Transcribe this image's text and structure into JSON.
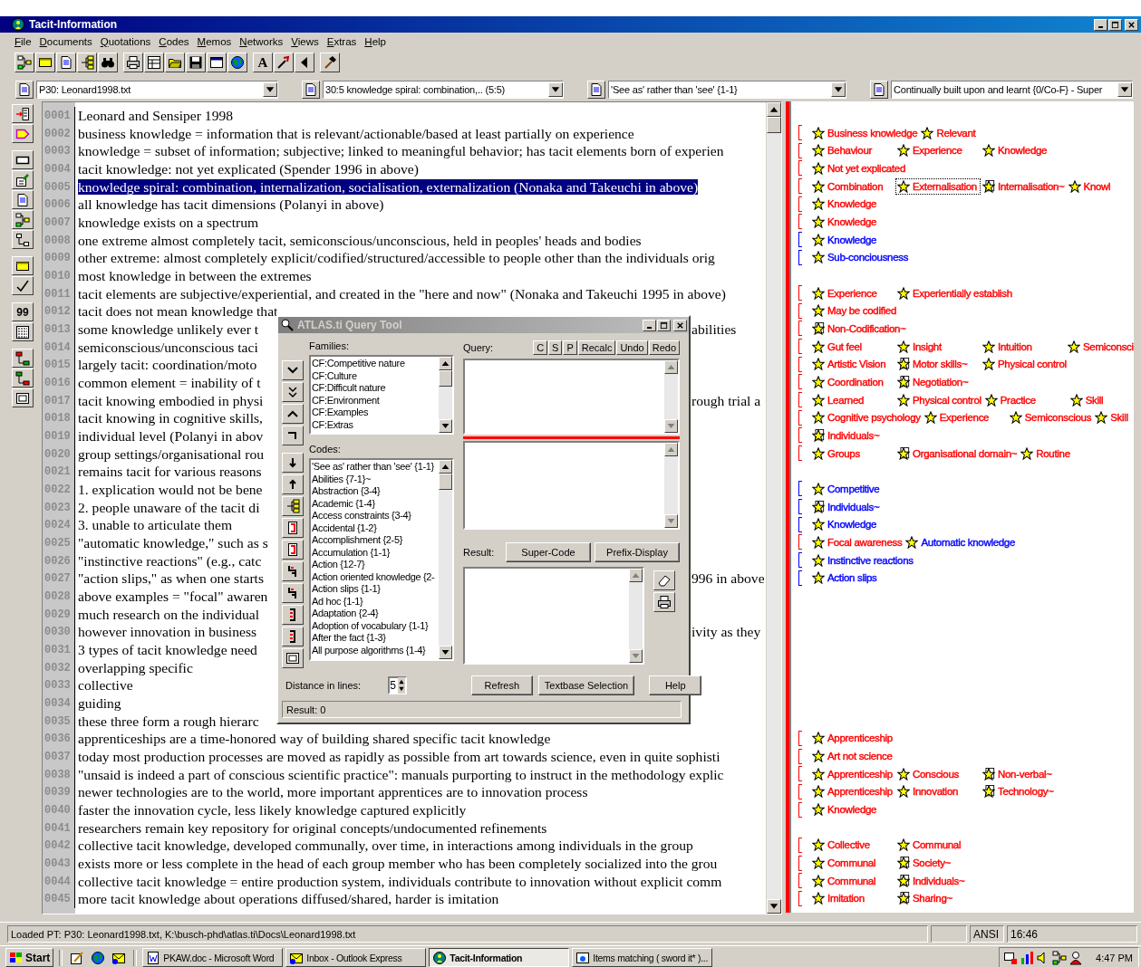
{
  "window": {
    "title": "Tacit-Information"
  },
  "menu": [
    "File",
    "Documents",
    "Quotations",
    "Codes",
    "Memos",
    "Networks",
    "Views",
    "Extras",
    "Help"
  ],
  "toolbar": [
    {
      "kind": "network"
    },
    {
      "kind": "note"
    },
    {
      "kind": "document"
    },
    {
      "kind": "tree"
    },
    {
      "kind": "binoculars"
    },
    {
      "kind": "printer"
    },
    {
      "kind": "table"
    },
    {
      "kind": "folder"
    },
    {
      "kind": "disk"
    },
    {
      "kind": "window"
    },
    {
      "kind": "globe"
    },
    {
      "kind": "text",
      "label": "A"
    },
    {
      "kind": "wand"
    },
    {
      "kind": "back"
    },
    {
      "kind": "hammer"
    }
  ],
  "selectors": [
    {
      "value": "P30: Leonard1998.txt"
    },
    {
      "value": "30:5 knowledge spiral: combination,.. (5:5)"
    },
    {
      "value": "'See as' rather than 'see' {1-1}"
    },
    {
      "value": "Continually built upon and learnt {0/Co-F} - Super"
    }
  ],
  "side_tools": [
    {
      "kind": "import"
    },
    {
      "kind": "tag"
    },
    {
      "kind": "rect"
    },
    {
      "kind": "edit"
    },
    {
      "kind": "document"
    },
    {
      "kind": "network"
    },
    {
      "kind": "connector"
    },
    {
      "kind": "note"
    },
    {
      "kind": "check"
    },
    {
      "kind": "text",
      "label": "99"
    },
    {
      "kind": "list"
    },
    {
      "kind": "link-red"
    },
    {
      "kind": "link-green"
    },
    {
      "kind": "frame"
    }
  ],
  "lines": [
    {
      "number": "0001",
      "text": "Leonard and Sensiper 1998",
      "selected": false
    },
    {
      "number": "0002",
      "text": "business knowledge = information that is relevant/actionable/based at least partially on experience",
      "selected": false,
      "codes": [
        {
          "label": "Business knowledge",
          "color": "#ff0000",
          "kind": "plain",
          "selected": false
        },
        {
          "label": "Relevant",
          "color": "#ff0000",
          "kind": "plain",
          "selected": false
        }
      ]
    },
    {
      "number": "0003",
      "text": "knowledge = subset of information; subjective; linked to meaningful behavior; has tacit elements born of experien",
      "selected": false,
      "codes": [
        {
          "label": "Behaviour",
          "color": "#ff0000",
          "kind": "plain",
          "selected": false
        },
        {
          "label": "Experience",
          "color": "#ff0000",
          "kind": "plain",
          "selected": false
        },
        {
          "label": "Knowledge",
          "color": "#ff0000",
          "kind": "plain",
          "selected": false
        }
      ]
    },
    {
      "number": "0004",
      "text": "tacit knowledge: not yet explicated (Spender 1996 in above)",
      "selected": false,
      "codes": [
        {
          "label": "Not yet explicated",
          "color": "#ff0000",
          "kind": "plain",
          "selected": false
        }
      ]
    },
    {
      "number": "0005",
      "text": "knowledge spiral: combination, internalization, socialisation, externalization (Nonaka and Takeuchi in above)",
      "selected": true,
      "codes": [
        {
          "label": "Combination",
          "color": "#ff0000",
          "kind": "plain",
          "selected": false
        },
        {
          "label": "Externalisation",
          "color": "#ff0000",
          "kind": "plain",
          "selected": true
        },
        {
          "label": "Internalisation~",
          "color": "#ff0000",
          "kind": "commented",
          "selected": false
        },
        {
          "label": "Knowl",
          "color": "#ff0000",
          "kind": "plain",
          "selected": false
        }
      ]
    },
    {
      "number": "0006",
      "text": "all knowledge has tacit dimensions (Polanyi in above)",
      "selected": false,
      "codes": [
        {
          "label": "Knowledge",
          "color": "#ff0000",
          "kind": "plain",
          "selected": false
        }
      ]
    },
    {
      "number": "0007",
      "text": "knowledge exists on a spectrum",
      "selected": false,
      "codes": [
        {
          "label": "Knowledge",
          "color": "#ff0000",
          "kind": "plain",
          "selected": false
        }
      ]
    },
    {
      "number": "0008",
      "text": "one extreme almost completely tacit, semiconscious/unconscious, held in peoples' heads and bodies",
      "selected": false,
      "codes": [
        {
          "label": "Knowledge",
          "color": "#0000ff",
          "kind": "plain",
          "selected": false
        }
      ]
    },
    {
      "number": "0009",
      "text": "other extreme: almost completely explicit/codified/structured/accessible to people other than the individuals orig",
      "selected": false,
      "codes": [
        {
          "label": "Sub-conciousness",
          "color": "#0000ff",
          "kind": "plain",
          "selected": false
        }
      ]
    },
    {
      "number": "0010",
      "text": "most knowledge in between the extremes",
      "selected": false
    },
    {
      "number": "0011",
      "text": "tacit elements are subjective/experiential, and created in the \"here and now\" (Nonaka and Takeuchi 1995 in above)",
      "selected": false,
      "codes": [
        {
          "label": "Experience",
          "color": "#ff0000",
          "kind": "plain",
          "selected": false
        },
        {
          "label": "Experientially establish",
          "color": "#ff0000",
          "kind": "plain",
          "selected": false
        }
      ]
    },
    {
      "number": "0012",
      "text": "tacit does not mean knowledge that",
      "selected": false,
      "codes": [
        {
          "label": "May be codified",
          "color": "#ff0000",
          "kind": "plain",
          "selected": false
        }
      ]
    },
    {
      "number": "0013",
      "text": "some knowledge unlikely ever t",
      "right": "abilities",
      "selected": false,
      "codes": [
        {
          "label": "Non-Codification~",
          "color": "#ff0000",
          "kind": "commented",
          "selected": false
        }
      ]
    },
    {
      "number": "0014",
      "text": "semiconscious/unconscious taci",
      "selected": false,
      "codes": [
        {
          "label": "Gut feel",
          "color": "#ff0000",
          "kind": "plain",
          "selected": false
        },
        {
          "label": "Insight",
          "color": "#ff0000",
          "kind": "plain",
          "selected": false
        },
        {
          "label": "Intuition",
          "color": "#ff0000",
          "kind": "plain",
          "selected": false
        },
        {
          "label": "Semiconsci",
          "color": "#ff0000",
          "kind": "plain",
          "selected": false
        }
      ]
    },
    {
      "number": "0015",
      "text": "largely tacit: coordination/moto",
      "selected": false,
      "codes": [
        {
          "label": "Artistic Vision",
          "color": "#ff0000",
          "kind": "plain",
          "selected": false
        },
        {
          "label": "Motor skills~",
          "color": "#ff0000",
          "kind": "commented",
          "selected": false
        },
        {
          "label": "Physical control",
          "color": "#ff0000",
          "kind": "plain",
          "selected": false
        }
      ]
    },
    {
      "number": "0016",
      "text": "common element = inability of t",
      "selected": false,
      "codes": [
        {
          "label": "Coordination",
          "color": "#ff0000",
          "kind": "plain",
          "selected": false
        },
        {
          "label": "Negotiation~",
          "color": "#ff0000",
          "kind": "commented",
          "selected": false
        }
      ]
    },
    {
      "number": "0017",
      "text": "tacit knowing embodied in physi",
      "right": "rough trial a",
      "selected": false,
      "codes": [
        {
          "label": "Learned",
          "color": "#ff0000",
          "kind": "plain",
          "selected": false
        },
        {
          "label": "Physical control",
          "color": "#ff0000",
          "kind": "plain",
          "selected": false
        },
        {
          "label": "Practice",
          "color": "#ff0000",
          "kind": "plain",
          "selected": false
        },
        {
          "label": "Skill",
          "color": "#ff0000",
          "kind": "plain",
          "selected": false
        }
      ]
    },
    {
      "number": "0018",
      "text": "tacit knowing in cognitive skills,",
      "selected": false,
      "codes": [
        {
          "label": "Cognitive psychology",
          "color": "#ff0000",
          "kind": "plain",
          "selected": false
        },
        {
          "label": "Experience",
          "color": "#ff0000",
          "kind": "plain",
          "selected": false
        },
        {
          "label": "Semiconscious",
          "color": "#ff0000",
          "kind": "plain",
          "selected": false
        },
        {
          "label": "Skill",
          "color": "#ff0000",
          "kind": "plain",
          "selected": false
        }
      ]
    },
    {
      "number": "0019",
      "text": "individual level (Polanyi in abov",
      "selected": false,
      "codes": [
        {
          "label": "Individuals~",
          "color": "#ff0000",
          "kind": "commented",
          "selected": false
        }
      ]
    },
    {
      "number": "0020",
      "text": "group settings/organisational rou",
      "selected": false,
      "codes": [
        {
          "label": "Groups",
          "color": "#ff0000",
          "kind": "plain",
          "selected": false
        },
        {
          "label": "Organisational domain~",
          "color": "#ff0000",
          "kind": "commented",
          "selected": false
        },
        {
          "label": "Routine",
          "color": "#ff0000",
          "kind": "plain",
          "selected": false
        }
      ]
    },
    {
      "number": "0021",
      "text": "remains tacit for various reasons",
      "selected": false
    },
    {
      "number": "0022",
      "text": "1. explication would not be bene",
      "selected": false,
      "codes": [
        {
          "label": "Competitive",
          "color": "#0000ff",
          "kind": "plain",
          "selected": false
        }
      ]
    },
    {
      "number": "0023",
      "text": "2. people unaware of the tacit di",
      "selected": false,
      "codes": [
        {
          "label": "Individuals~",
          "color": "#0000ff",
          "kind": "commented",
          "selected": false
        }
      ]
    },
    {
      "number": "0024",
      "text": "3. unable to articulate them",
      "selected": false,
      "codes": [
        {
          "label": "Knowledge",
          "color": "#0000ff",
          "kind": "plain",
          "selected": false
        }
      ]
    },
    {
      "number": "0025",
      "text": "\"automatic knowledge,\" such as s",
      "selected": false,
      "codes": [
        {
          "label": "Focal awareness",
          "color": "#ff0000",
          "kind": "plain",
          "selected": false
        },
        {
          "label": "Automatic knowledge",
          "color": "#0000ff",
          "kind": "plain",
          "selected": false
        }
      ]
    },
    {
      "number": "0026",
      "text": "\"instinctive reactions\" (e.g., catc",
      "selected": false,
      "codes": [
        {
          "label": "Instinctive reactions",
          "color": "#0000ff",
          "kind": "plain",
          "selected": false
        }
      ]
    },
    {
      "number": "0027",
      "text": "\"action slips,\" as when one starts",
      "right": "996 in above",
      "selected": false,
      "codes": [
        {
          "label": "Action slips",
          "color": "#0000ff",
          "kind": "plain",
          "selected": false
        }
      ]
    },
    {
      "number": "0028",
      "text": "above examples = \"focal\" awaren",
      "selected": false
    },
    {
      "number": "0029",
      "text": "much research on the individual",
      "selected": false
    },
    {
      "number": "0030",
      "text": "however innovation in business",
      "right": "ivity as they",
      "selected": false
    },
    {
      "number": "0031",
      "text": "3 types of tacit knowledge need",
      "selected": false
    },
    {
      "number": "0032",
      "text": "overlapping specific",
      "selected": false
    },
    {
      "number": "0033",
      "text": "collective",
      "selected": false
    },
    {
      "number": "0034",
      "text": "guiding",
      "selected": false
    },
    {
      "number": "0035",
      "text": "these three form a rough hierarc",
      "selected": false
    },
    {
      "number": "0036",
      "text": "apprenticeships are a time-honored way of building shared specific tacit knowledge",
      "selected": false,
      "codes": [
        {
          "label": "Apprenticeship",
          "color": "#ff0000",
          "kind": "plain",
          "selected": false
        }
      ]
    },
    {
      "number": "0037",
      "text": "today most production processes are moved as rapidly as possible from art towards science, even in quite sophisti",
      "selected": false,
      "codes": [
        {
          "label": "Art not science",
          "color": "#ff0000",
          "kind": "plain",
          "selected": false
        }
      ]
    },
    {
      "number": "0038",
      "text": "\"unsaid is indeed a part of conscious scientific practice\": manuals purporting to instruct in the methodology explic",
      "selected": false,
      "codes": [
        {
          "label": "Apprenticeship",
          "color": "#ff0000",
          "kind": "plain",
          "selected": false
        },
        {
          "label": "Conscious",
          "color": "#ff0000",
          "kind": "plain",
          "selected": false
        },
        {
          "label": "Non-verbal~",
          "color": "#ff0000",
          "kind": "commented",
          "selected": false
        }
      ]
    },
    {
      "number": "0039",
      "text": "newer technologies are to the world, more important apprentices are to innovation process",
      "selected": false,
      "codes": [
        {
          "label": "Apprenticeship",
          "color": "#ff0000",
          "kind": "plain",
          "selected": false
        },
        {
          "label": "Innovation",
          "color": "#ff0000",
          "kind": "plain",
          "selected": false
        },
        {
          "label": "Technology~",
          "color": "#ff0000",
          "kind": "commented",
          "selected": false
        }
      ]
    },
    {
      "number": "0040",
      "text": "faster the innovation cycle, less likely knowledge captured explicitly",
      "selected": false,
      "codes": [
        {
          "label": "Knowledge",
          "color": "#ff0000",
          "kind": "plain",
          "selected": false
        }
      ]
    },
    {
      "number": "0041",
      "text": "researchers remain key repository for original concepts/undocumented refinements",
      "selected": false
    },
    {
      "number": "0042",
      "text": "collective tacit knowledge, developed communally, over time, in interactions among individuals in the group",
      "selected": false,
      "codes": [
        {
          "label": "Collective",
          "color": "#ff0000",
          "kind": "plain",
          "selected": false
        },
        {
          "label": "Communal",
          "color": "#ff0000",
          "kind": "plain",
          "selected": false
        }
      ]
    },
    {
      "number": "0043",
      "text": "exists more or less complete in the head of each group member who has been completely socialized into the grou",
      "selected": false,
      "codes": [
        {
          "label": "Communal",
          "color": "#ff0000",
          "kind": "plain",
          "selected": false
        },
        {
          "label": "Society~",
          "color": "#ff0000",
          "kind": "commented",
          "selected": false
        }
      ]
    },
    {
      "number": "0044",
      "text": "collective tacit knowledge = entire production system, individuals contribute to innovation without explicit comm",
      "selected": false,
      "codes": [
        {
          "label": "Communal",
          "color": "#ff0000",
          "kind": "plain",
          "selected": false
        },
        {
          "label": "Individuals~",
          "color": "#ff0000",
          "kind": "commented",
          "selected": false
        }
      ]
    },
    {
      "number": "0045",
      "text": "more tacit knowledge about operations diffused/shared, harder is imitation",
      "selected": false,
      "codes": [
        {
          "label": "Imitation",
          "color": "#ff0000",
          "kind": "plain",
          "selected": false
        },
        {
          "label": "Sharing~",
          "color": "#ff0000",
          "kind": "commented",
          "selected": false
        }
      ]
    }
  ],
  "query_tool": {
    "title": "ATLAS.ti Query Tool",
    "families_label": "Families:",
    "families": [
      "CF:Competitive nature",
      "CF:Culture",
      "CF:Difficult nature",
      "CF:Environment",
      "CF:Examples",
      "CF:Extras"
    ],
    "codes_label": "Codes:",
    "codes": [
      "'See as' rather than 'see' {1-1}",
      "Abilities {7-1}~",
      "Abstraction {3-4}",
      "Academic {1-4}",
      "Access constraints {3-4}",
      "Accidental {1-2}",
      "Accomplishment {2-5}",
      "Accumulation {1-1}",
      "Action {12-7}",
      "Action oriented knowledge {2-",
      "Action slips {1-1}",
      "Ad hoc {1-1}",
      "Adaptation {2-4}",
      "Adoption of vocabulary {1-1}",
      "After the fact {1-3}",
      "All purpose algorithms {1-4}"
    ],
    "operators": [
      {
        "kind": "chevron-down"
      },
      {
        "kind": "double-chevron"
      },
      {
        "kind": "chevron-up"
      },
      {
        "kind": "corner"
      },
      {
        "kind": "arrow-down"
      },
      {
        "kind": "arrow-up"
      },
      {
        "kind": "tree"
      },
      {
        "kind": "red-doc"
      },
      {
        "kind": "red-doc"
      },
      {
        "kind": "red-hook"
      },
      {
        "kind": "red-hook"
      },
      {
        "kind": "bracket"
      },
      {
        "kind": "bracket"
      },
      {
        "kind": "frame"
      }
    ],
    "query_label": "Query:",
    "query_buttons": [
      "C",
      "S",
      "P",
      "Recalc",
      "Undo",
      "Redo"
    ],
    "result_label": "Result:",
    "result_buttons": [
      "Super-Code",
      "Prefix-Display"
    ],
    "distance_label": "Distance in lines:",
    "distance": "5",
    "buttons": [
      "Refresh",
      "Textbase Selection",
      "Help"
    ],
    "status": "Result: 0"
  },
  "status_bar": {
    "message": "Loaded PT: P30: Leonard1998.txt, K:\\busch-phd\\atlas.ti\\Docs\\Leonard1998.txt",
    "encoding": "ANSI",
    "time": "16:46"
  },
  "taskbar": {
    "start": "Start",
    "quick_launch": [
      {
        "kind": "pen"
      },
      {
        "kind": "globe"
      },
      {
        "kind": "mail"
      }
    ],
    "tasks": [
      {
        "label": "PKAW.doc - Microsoft Word",
        "kind": "word",
        "selected": false
      },
      {
        "label": "Inbox - Outlook Express",
        "kind": "mail",
        "selected": false
      },
      {
        "label": "Tacit-Information",
        "kind": "app",
        "selected": true
      },
      {
        "label": "Items matching ( sword it* )...",
        "kind": "browser",
        "selected": false
      }
    ],
    "tray": [
      {
        "kind": "monitor"
      },
      {
        "kind": "chart"
      },
      {
        "kind": "speaker"
      },
      {
        "kind": "network"
      },
      {
        "kind": "user"
      }
    ],
    "clock": "4:47 PM"
  }
}
